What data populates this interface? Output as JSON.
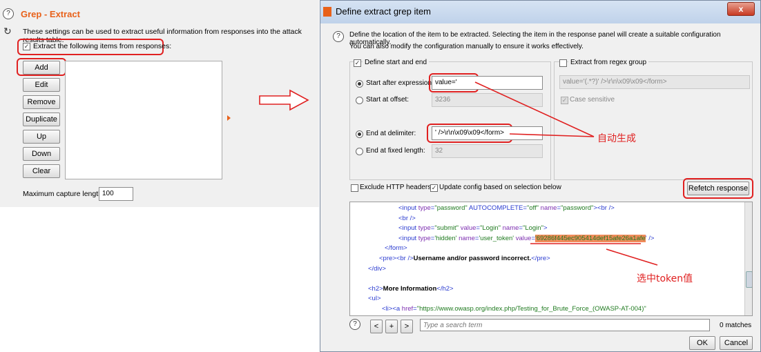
{
  "left_panel": {
    "title": "Grep - Extract",
    "description": "These settings can be used to extract useful information from responses into the attack results table.",
    "extract_checkbox_label": "Extract the following items from responses:",
    "buttons": [
      "Add",
      "Edit",
      "Remove",
      "Duplicate",
      "Up",
      "Down",
      "Clear"
    ],
    "max_capture_label": "Maximum capture length:",
    "max_capture_value": "100"
  },
  "dialog": {
    "title": "Define extract grep item",
    "close_label": "x",
    "description_line1": "Define the location of the item to be extracted. Selecting the item in the response panel will create a suitable configuration automatically.",
    "description_line2": "You can also modify the configuration manually to ensure it works effectively.",
    "start_end": {
      "group_label": "Define start and end",
      "start_after_label": "Start after expression:",
      "start_after_value": "value='",
      "start_offset_label": "Start at offset:",
      "start_offset_value": "3236",
      "end_delim_label": "End at delimiter:",
      "end_delim_value": "' />\\r\\n\\x09\\x09</form>",
      "end_fixed_label": "End at fixed length:",
      "end_fixed_value": "32"
    },
    "regex": {
      "group_label": "Extract from regex group",
      "regex_value": "value='(.*?)' />\\r\\n\\x09\\x09</form>",
      "case_label": "Case sensitive"
    },
    "exclude_headers_label": "Exclude HTTP headers",
    "update_config_label": "Update config based on selection below",
    "refetch_label": "Refetch response",
    "code_lines": [
      {
        "indent": 64,
        "parts": [
          [
            "tag",
            "<input "
          ],
          [
            "attr",
            "type"
          ],
          [
            "tag",
            "="
          ],
          [
            "val",
            "\"password\""
          ],
          [
            "tag",
            " AUTOCOMPLETE"
          ],
          [
            "tag",
            "="
          ],
          [
            "val",
            "\"off\""
          ],
          [
            "attr",
            " name"
          ],
          [
            "tag",
            "="
          ],
          [
            "val",
            "\"password\""
          ],
          [
            "tag",
            "><br />"
          ]
        ]
      },
      {
        "indent": 64,
        "parts": [
          [
            "tag",
            "<br />"
          ]
        ]
      },
      {
        "indent": 64,
        "parts": [
          [
            "tag",
            "<input "
          ],
          [
            "attr",
            "type"
          ],
          [
            "tag",
            "="
          ],
          [
            "val",
            "\"submit\""
          ],
          [
            "attr",
            " value"
          ],
          [
            "tag",
            "="
          ],
          [
            "val",
            "\"Login\""
          ],
          [
            "attr",
            " name"
          ],
          [
            "tag",
            "="
          ],
          [
            "val",
            "\"Login\""
          ],
          [
            "tag",
            ">"
          ]
        ]
      },
      {
        "indent": 64,
        "parts": [
          [
            "tag",
            "<input "
          ],
          [
            "attr",
            "type"
          ],
          [
            "tag",
            "="
          ],
          [
            "val",
            "'hidden'"
          ],
          [
            "attr",
            " name"
          ],
          [
            "tag",
            "="
          ],
          [
            "val",
            "'user_token'"
          ],
          [
            "attr",
            " value"
          ],
          [
            "tag",
            "="
          ],
          [
            "sel",
            "'69286f445ec905414def15afe26a1afe"
          ],
          [
            "tag",
            "' />"
          ]
        ]
      },
      {
        "indent": 44,
        "parts": [
          [
            "tag",
            "</form>"
          ]
        ]
      },
      {
        "indent": 36,
        "parts": [
          [
            "tag",
            "<pre><br />"
          ],
          [
            "bold",
            "Username and/or password incorrect."
          ],
          [
            "tag",
            "</pre>"
          ]
        ]
      },
      {
        "indent": 20,
        "parts": [
          [
            "tag",
            "</div>"
          ]
        ]
      },
      {
        "indent": 0,
        "parts": []
      },
      {
        "indent": 20,
        "parts": [
          [
            "tag",
            "<h2>"
          ],
          [
            "bold",
            "More Information"
          ],
          [
            "tag",
            "</h2>"
          ]
        ]
      },
      {
        "indent": 20,
        "parts": [
          [
            "tag",
            "<ul>"
          ]
        ]
      },
      {
        "indent": 40,
        "parts": [
          [
            "tag",
            "<li><a "
          ],
          [
            "attr",
            "href"
          ],
          [
            "tag",
            "="
          ],
          [
            "val",
            "\"https://www.owasp.org/index.php/Testing_for_Brute_Force_(OWASP-AT-004)\""
          ]
        ]
      }
    ],
    "search": {
      "prev": "<",
      "add": "+",
      "next": ">",
      "placeholder": "Type a search term",
      "matches": "0 matches"
    },
    "ok_label": "OK",
    "cancel_label": "Cancel"
  },
  "annotations": {
    "auto_generated": "自动生成",
    "select_token": "选中token值"
  },
  "colors": {
    "accent_orange": "#e8611a",
    "annotation_red": "#e02020",
    "selection_bg": "#f08b5a"
  }
}
